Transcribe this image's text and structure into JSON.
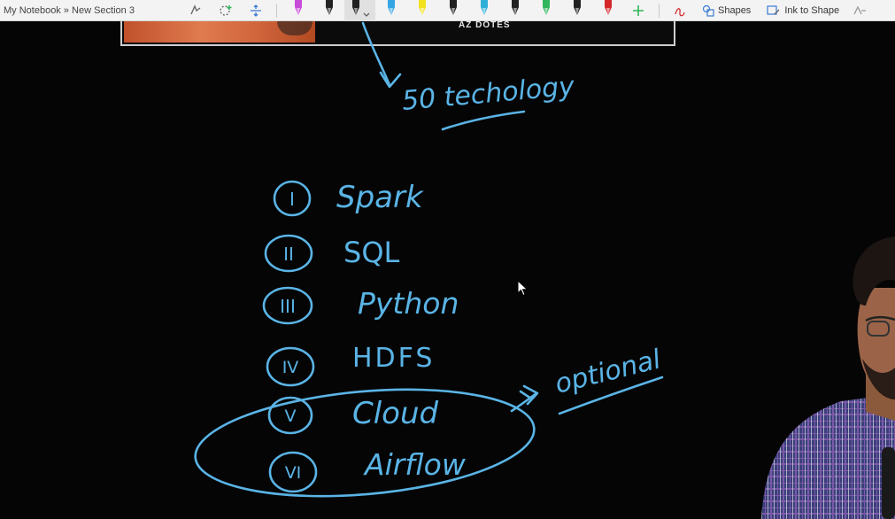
{
  "toolbar": {
    "breadcrumb": "My Notebook » New Section 3",
    "shapes_label": "Shapes",
    "ink_to_shape_label": "Ink to Shape",
    "pens": [
      {
        "icon": "pen-icon",
        "color": "#c84bd8"
      },
      {
        "icon": "pen-icon",
        "color": "#222222"
      },
      {
        "icon": "pen-icon",
        "color": "#222222"
      },
      {
        "icon": "pen-icon",
        "color": "#34a6e4"
      },
      {
        "icon": "highlighter-icon",
        "color": "#f2e21e"
      },
      {
        "icon": "pen-icon",
        "color": "#222222"
      },
      {
        "icon": "pen-icon",
        "color": "#2fb0d8"
      },
      {
        "icon": "pen-icon",
        "color": "#222222"
      },
      {
        "icon": "pen-icon",
        "color": "#2fb65b"
      },
      {
        "icon": "pen-icon",
        "color": "#222222"
      },
      {
        "icon": "pen-icon",
        "color": "#d4262a"
      }
    ],
    "active_pen_index": 2,
    "add_pen_icon": "plus-icon"
  },
  "slide": {
    "caption": "AZ DOTES"
  },
  "notes": {
    "header": "50 techology",
    "items": [
      {
        "numeral": "I",
        "text": "Spark"
      },
      {
        "numeral": "II",
        "text": "SQL"
      },
      {
        "numeral": "III",
        "text": "Python"
      },
      {
        "numeral": "IV",
        "text": "HDFS"
      },
      {
        "numeral": "V",
        "text": "Cloud"
      },
      {
        "numeral": "VI",
        "text": "Airflow"
      }
    ],
    "annotation": "optional"
  },
  "colors": {
    "ink": "#5ab4e6",
    "background": "#050505",
    "toolbar_bg": "#f3f3f3"
  }
}
